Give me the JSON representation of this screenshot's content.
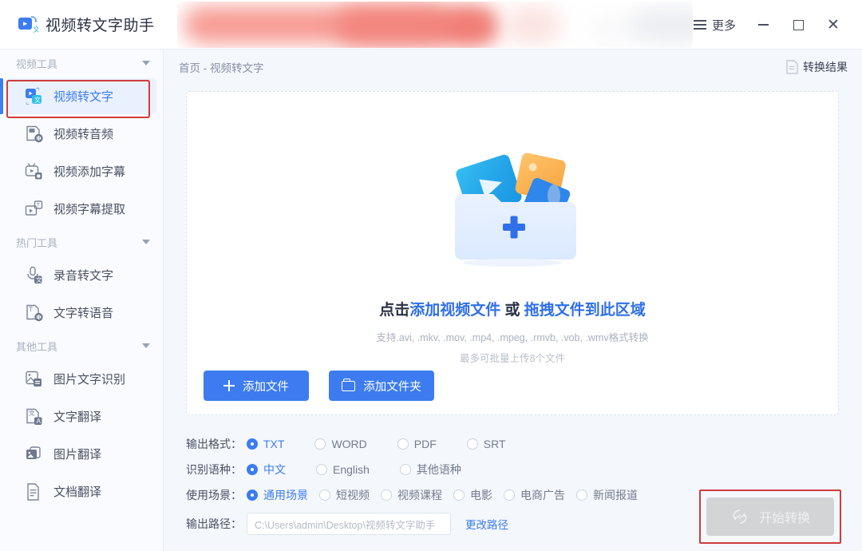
{
  "window": {
    "title": "视频转文字助手",
    "more_label": "更多",
    "minimize": "−",
    "maximize": "□",
    "close": "✕"
  },
  "sidebar": {
    "sections": [
      {
        "title": "视频工具",
        "items": [
          {
            "label": "视频转文字",
            "icon": "video-to-text-icon",
            "active": true
          },
          {
            "label": "视频转音频",
            "icon": "video-to-audio-icon",
            "active": false
          },
          {
            "label": "视频添加字幕",
            "icon": "video-add-subtitle-icon",
            "active": false
          },
          {
            "label": "视频字幕提取",
            "icon": "video-extract-subtitle-icon",
            "active": false
          }
        ]
      },
      {
        "title": "热门工具",
        "items": [
          {
            "label": "录音转文字",
            "icon": "mic-to-text-icon",
            "active": false
          },
          {
            "label": "文字转语音",
            "icon": "text-to-speech-icon",
            "active": false
          }
        ]
      },
      {
        "title": "其他工具",
        "items": [
          {
            "label": "图片文字识别",
            "icon": "image-ocr-icon",
            "active": false
          },
          {
            "label": "文字翻译",
            "icon": "text-translate-icon",
            "active": false
          },
          {
            "label": "图片翻译",
            "icon": "image-translate-icon",
            "active": false
          },
          {
            "label": "文档翻译",
            "icon": "document-translate-icon",
            "active": false
          }
        ]
      }
    ]
  },
  "main": {
    "breadcrumb": "首页 - 视频转文字",
    "result_button": "转换结果",
    "dropzone": {
      "title_click": "点击",
      "title_add": "添加视频文件",
      "title_or": " 或 ",
      "title_drag": "拖拽文件到此区域",
      "formats": "支持.avi, .mkv, .mov, .mp4, .mpeg, .rmvb, .vob, .wmv格式转换",
      "batch": "最多可批量上传8个文件",
      "add_file_button": "添加文件",
      "add_folder_button": "添加文件夹"
    },
    "options": {
      "format_label": "输出格式：",
      "formats": [
        {
          "label": "TXT",
          "selected": true
        },
        {
          "label": "WORD",
          "selected": false
        },
        {
          "label": "PDF",
          "selected": false
        },
        {
          "label": "SRT",
          "selected": false
        }
      ],
      "language_label": "识别语种：",
      "languages": [
        {
          "label": "中文",
          "selected": true
        },
        {
          "label": "English",
          "selected": false
        },
        {
          "label": "其他语种",
          "selected": false
        }
      ],
      "scene_label": "使用场景：",
      "scenes": [
        {
          "label": "通用场景",
          "selected": true
        },
        {
          "label": "短视频",
          "selected": false
        },
        {
          "label": "视频课程",
          "selected": false
        },
        {
          "label": "电影",
          "selected": false
        },
        {
          "label": "电商广告",
          "selected": false
        },
        {
          "label": "新闻报道",
          "selected": false
        }
      ],
      "path_label": "输出路径：",
      "path_value": "C:\\Users\\admin\\Desktop\\视频转文字助手",
      "change_path": "更改路径"
    },
    "start_button": "开始转换"
  },
  "colors": {
    "accent": "#3c7cf0",
    "highlight_box": "#d03b3b",
    "disabled_button": "#d3d4d6",
    "sidebar_bg": "#fafbfe",
    "page_bg": "#f4f7fc"
  }
}
